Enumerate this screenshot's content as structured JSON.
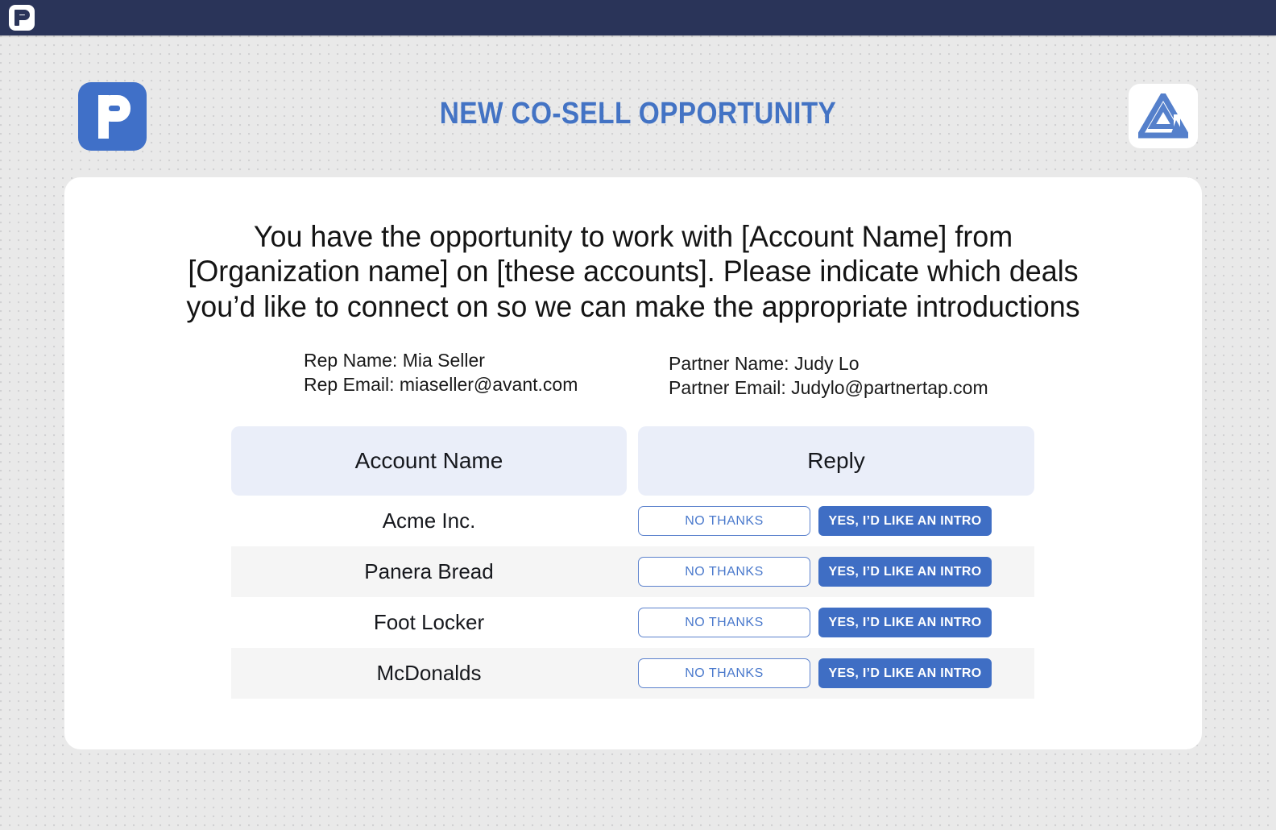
{
  "topbar": {
    "logo_icon": "partnertap-p-logo-icon"
  },
  "header": {
    "brand_logo_icon": "partnertap-p-logo-icon",
    "title": "NEW CO-SELL OPPORTUNITY",
    "partner_logo_icon": "avant-triangle-logo-icon",
    "accent_color": "#4373c4"
  },
  "body": {
    "intro": "You have the opportunity to work with [Account Name] from [Organization name] on [these accounts]. Please indicate which deals you’d like to connect on so we can make the appropriate introductions"
  },
  "contacts": {
    "rep": {
      "name_line": "Rep Name: Mia Seller",
      "email_line": "Rep Email: miaseller@avant.com"
    },
    "partner": {
      "name_line": "Partner Name: Judy Lo",
      "email_line": "Partner Email: Judylo@partnertap.com"
    }
  },
  "table": {
    "headers": {
      "account": "Account Name",
      "reply": "Reply"
    },
    "decline_label": "NO THANKS",
    "accept_label": "YES, I’D LIKE AN INTRO",
    "rows": [
      {
        "account": "Acme Inc."
      },
      {
        "account": "Panera Bread"
      },
      {
        "account": "Foot Locker"
      },
      {
        "account": "McDonalds"
      }
    ]
  },
  "colors": {
    "navy": "#2a3459",
    "brand_blue": "#4070c8",
    "button_blue": "#3f6ec4",
    "header_cell": "#eaeef9",
    "row_alt": "#f5f5f5",
    "page_bg": "#e9e9e9"
  }
}
